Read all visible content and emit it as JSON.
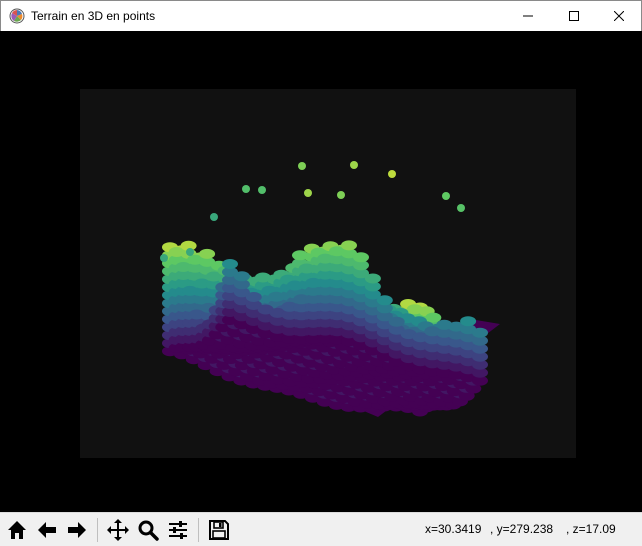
{
  "window": {
    "title": "Terrain en 3D en points",
    "controls": [
      "minimize",
      "maximize",
      "close"
    ]
  },
  "toolbar": {
    "buttons": [
      {
        "id": "home",
        "icon": "home-icon"
      },
      {
        "id": "back",
        "icon": "arrow-left-icon"
      },
      {
        "id": "forward",
        "icon": "arrow-right-icon"
      },
      {
        "id": "pan",
        "icon": "move-icon"
      },
      {
        "id": "zoom",
        "icon": "magnifier-icon"
      },
      {
        "id": "configure",
        "icon": "sliders-icon"
      },
      {
        "id": "save",
        "icon": "floppy-disk-icon"
      }
    ],
    "coords": {
      "x": "x=30.3419",
      "y": ", y=279.238",
      "z": ", z=17.09"
    }
  },
  "plot": {
    "background": "#111111",
    "colormap": "viridis",
    "colors": {
      "low": "#440154",
      "mid": "#21918c",
      "high": "#fde725"
    }
  }
}
